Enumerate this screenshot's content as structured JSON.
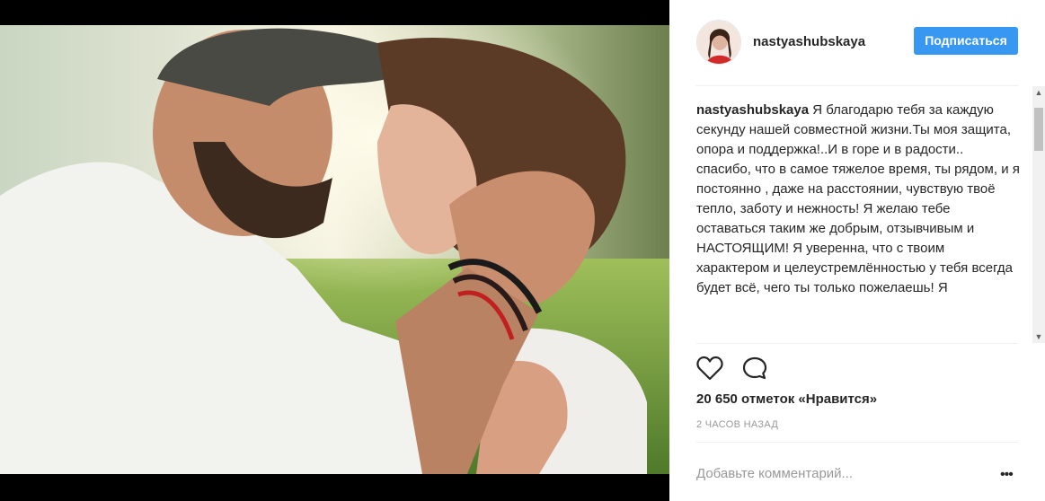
{
  "post": {
    "username": "nastyashubskaya",
    "follow_label": "Подписаться",
    "caption_author": "nastyashubskaya",
    "caption_text": "Я благодарю тебя за каждую секунду нашей совместной жизни.Ты моя защита, опора и поддержка!..И в горе и в радости.. спасибо, что в самое тяжелое время, ты рядом, и я постоянно , даже на расстоянии, чувствую твоё тепло, заботу и нежность! Я желаю тебе оставаться таким же добрым, отзывчивым и НАСТОЯЩИМ! Я уверенна, что с твоим характером и целеустремлённостью у тебя всегда будет всё, чего ты только пожелаешь! Я",
    "likes": "20 650 отметок «Нравится»",
    "time_ago": "2 ЧАСОВ НАЗАД",
    "comment_placeholder": "Добавьте комментарий...",
    "more_label": "•••"
  },
  "icons": {
    "like": "heart-icon",
    "comment": "comment-bubble-icon"
  }
}
